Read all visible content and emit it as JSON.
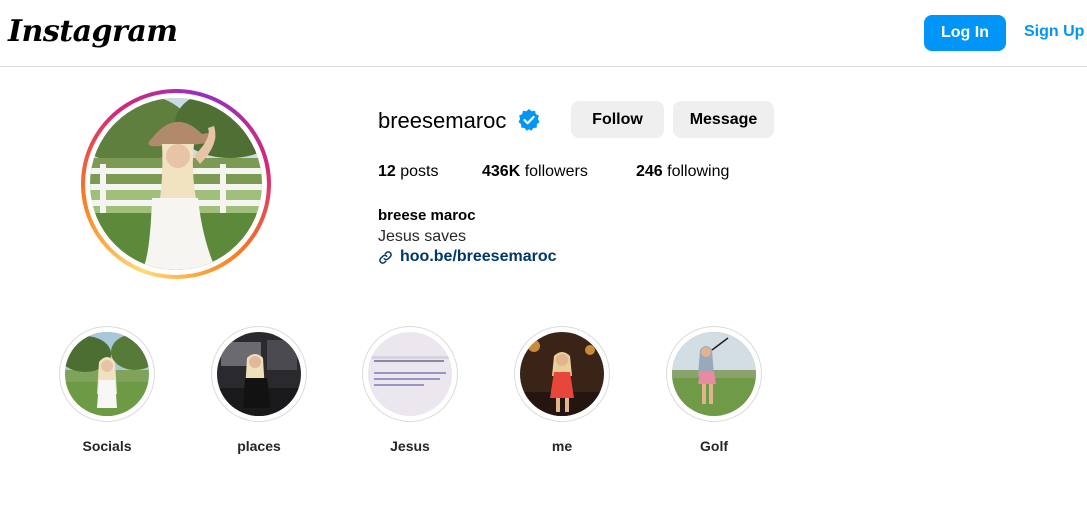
{
  "header": {
    "logo_text": "Instagram",
    "login_label": "Log In",
    "signup_label": "Sign Up",
    "accent_color": "#0095f6"
  },
  "profile": {
    "username": "breesemaroc",
    "verified_icon": "verified-badge-icon",
    "follow_label": "Follow",
    "message_label": "Message",
    "stats": {
      "posts_count": "12",
      "posts_label": " posts",
      "followers_count": "436K",
      "followers_label": " followers",
      "following_count": "246",
      "following_label": " following"
    },
    "full_name": "breese maroc",
    "bio": "Jesus saves",
    "link_icon": "link-icon",
    "link": "hoo.be/breesemaroc"
  },
  "highlights": [
    {
      "label": "Socials"
    },
    {
      "label": "places"
    },
    {
      "label": "Jesus"
    },
    {
      "label": "me"
    },
    {
      "label": "Golf"
    }
  ]
}
